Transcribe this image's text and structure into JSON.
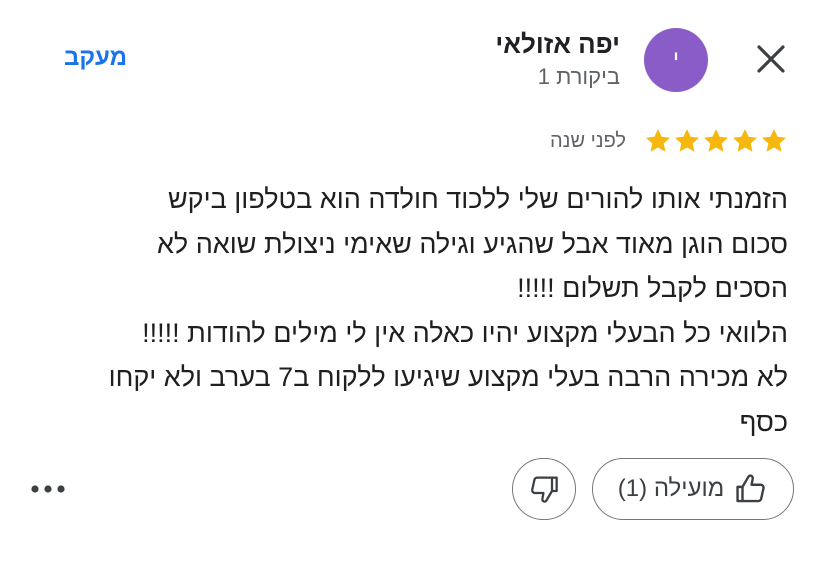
{
  "reviewer": {
    "name": "יפה אזולאי",
    "avatar_letter": "י",
    "avatar_color": "#8a5cc7",
    "review_count": "ביקורת 1"
  },
  "header": {
    "follow_label": "מעקב",
    "close_icon": "close-icon"
  },
  "review": {
    "rating": 5,
    "max_rating": 5,
    "star_color": "#f6b80f",
    "date": "לפני שנה",
    "text_lines": [
      "הזמנתי אותו להורים שלי ללכוד חולדה הוא בטלפון ביקש",
      "סכום הוגן מאוד אבל שהגיע וגילה שאימי ניצולת שואה לא",
      "הסכים לקבל תשלום !!!!!",
      "הלוואי כל הבעלי מקצוע יהיו כאלה אין לי מילים להודות !!!!!",
      "לא מכירה הרבה בעלי מקצוע שיגיעו ללקוח ב7 בערב ולא יקחו",
      "כסף"
    ]
  },
  "actions": {
    "helpful_label": "מועילה (1)",
    "helpful_icon": "thumbs-up-icon",
    "dislike_icon": "thumbs-down-icon",
    "more_icon": "more-horizontal-icon"
  },
  "colors": {
    "accent": "#1a73e8",
    "text": "#1f1f1f",
    "secondary_text": "#5f6368",
    "border": "#747775"
  }
}
